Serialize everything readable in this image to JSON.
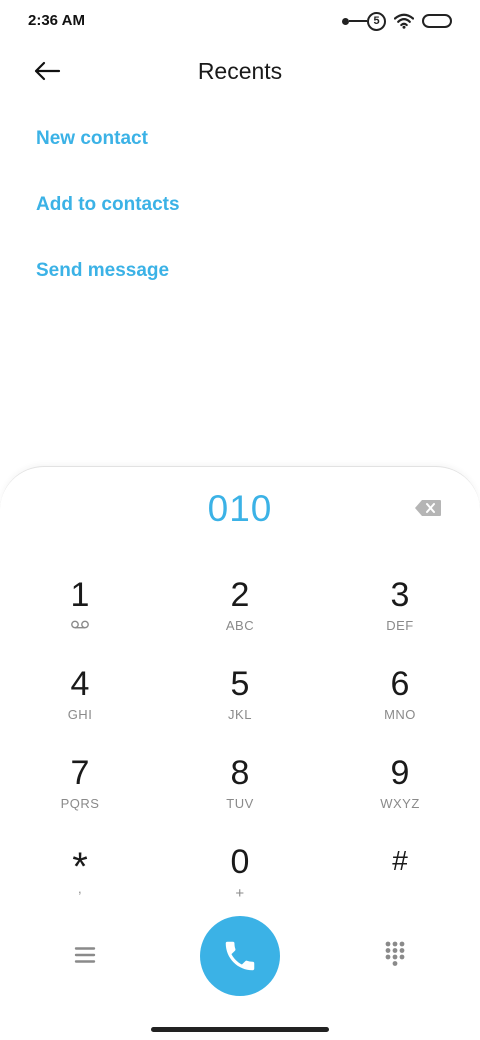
{
  "status_bar": {
    "time": "2:36 AM",
    "sim_indicator": "5"
  },
  "header": {
    "title": "Recents",
    "back_icon": "arrow-left-icon"
  },
  "actions": [
    {
      "label": "New contact"
    },
    {
      "label": "Add to contacts"
    },
    {
      "label": "Send message"
    }
  ],
  "dialer": {
    "number": "010",
    "keys": [
      {
        "digit": "1",
        "letters": ""
      },
      {
        "digit": "2",
        "letters": "ABC"
      },
      {
        "digit": "3",
        "letters": "DEF"
      },
      {
        "digit": "4",
        "letters": "GHI"
      },
      {
        "digit": "5",
        "letters": "JKL"
      },
      {
        "digit": "6",
        "letters": "MNO"
      },
      {
        "digit": "7",
        "letters": "PQRS"
      },
      {
        "digit": "8",
        "letters": "TUV"
      },
      {
        "digit": "9",
        "letters": "WXYZ"
      },
      {
        "digit": "*",
        "letters": ","
      },
      {
        "digit": "0",
        "letters": "+"
      },
      {
        "digit": "#",
        "letters": ""
      }
    ]
  },
  "colors": {
    "accent": "#3bb2e6",
    "text": "#1a1a1a",
    "secondary_text": "#8a8a8a"
  },
  "icons": [
    "arrow-left-icon",
    "backspace-icon",
    "voicemail-icon",
    "menu-icon",
    "phone-icon",
    "dialpad-icon",
    "wifi-icon",
    "battery-icon",
    "link-icon"
  ]
}
